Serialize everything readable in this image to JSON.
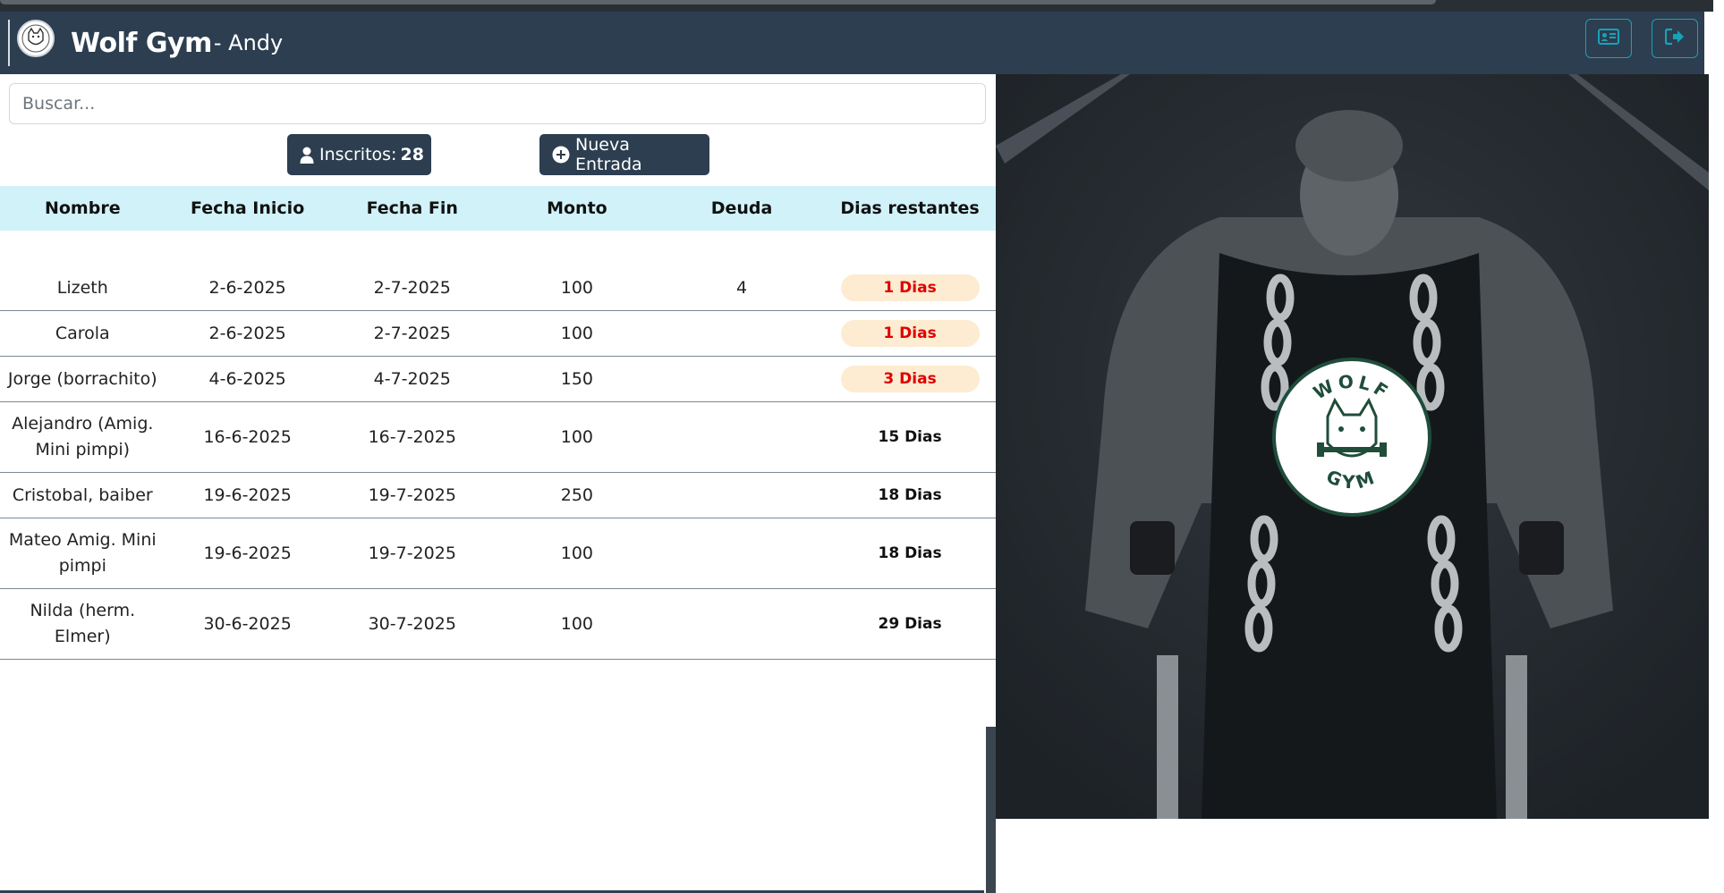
{
  "app": {
    "brand_name": "Wolf Gym",
    "user_suffix": "- Andy"
  },
  "search": {
    "placeholder": "Buscar..."
  },
  "actions": {
    "count_label": "Inscritos:",
    "count_value": "28",
    "new_entry_label": "Nueva Entrada"
  },
  "table": {
    "headers": [
      "Nombre",
      "Fecha Inicio",
      "Fecha Fin",
      "Monto",
      "Deuda",
      "Dias restantes"
    ],
    "rows": [
      {
        "nombre": "Lizeth",
        "inicio": "2-6-2025",
        "fin": "2-7-2025",
        "monto": "100",
        "deuda": "4",
        "dias": "1 Dias",
        "status": "warn"
      },
      {
        "nombre": "Carola",
        "inicio": "2-6-2025",
        "fin": "2-7-2025",
        "monto": "100",
        "deuda": "",
        "dias": "1 Dias",
        "status": "warn"
      },
      {
        "nombre": "Jorge (borrachito)",
        "inicio": "4-6-2025",
        "fin": "4-7-2025",
        "monto": "150",
        "deuda": "",
        "dias": "3 Dias",
        "status": "warn"
      },
      {
        "nombre": "Alejandro (Amig. Mini pimpi)",
        "inicio": "16-6-2025",
        "fin": "16-7-2025",
        "monto": "100",
        "deuda": "",
        "dias": "15 Dias",
        "status": "ok"
      },
      {
        "nombre": "Cristobal, baiber",
        "inicio": "19-6-2025",
        "fin": "19-7-2025",
        "monto": "250",
        "deuda": "",
        "dias": "18 Dias",
        "status": "ok"
      },
      {
        "nombre": "Mateo Amig. Mini pimpi",
        "inicio": "19-6-2025",
        "fin": "19-7-2025",
        "monto": "100",
        "deuda": "",
        "dias": "18 Dias",
        "status": "ok"
      },
      {
        "nombre": "Nilda (herm. Elmer)",
        "inicio": "30-6-2025",
        "fin": "30-7-2025",
        "monto": "100",
        "deuda": "",
        "dias": "29 Dias",
        "status": "ok"
      }
    ]
  },
  "hero": {
    "seal_top": "WOLF",
    "seal_bottom": "GYM"
  },
  "colors": {
    "navbar": "#2c3e50",
    "accent": "#17a2b8",
    "header_row": "#d1f2f9",
    "warn_badge": "#fdecd2",
    "warn_text": "#e00000"
  },
  "icons": {
    "logo": "wolf-logo-icon",
    "profile": "id-card-icon",
    "logout": "logout-icon",
    "count": "user-icon",
    "new": "plus-circle-icon"
  }
}
